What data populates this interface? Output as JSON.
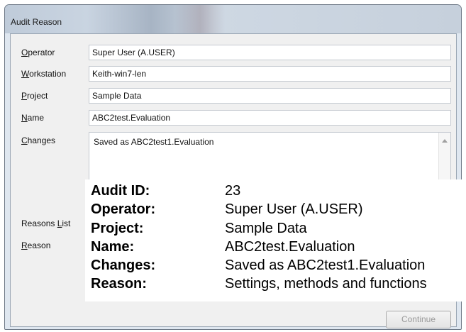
{
  "window": {
    "title": "Audit Reason"
  },
  "form": {
    "operator": {
      "label_ul": "O",
      "label_rest": "perator",
      "value": "Super User (A.USER)"
    },
    "workstation": {
      "label_ul": "W",
      "label_rest": "orkstation",
      "value": "Keith-win7-len"
    },
    "project": {
      "label_ul": "P",
      "label_rest": "roject",
      "value": "Sample Data"
    },
    "name": {
      "label_ul": "N",
      "label_rest": "ame",
      "value": "ABC2test.Evaluation"
    },
    "changes": {
      "label_ul": "C",
      "label_rest": "hanges",
      "value": "Saved as ABC2test1.Evaluation"
    },
    "reasons_list": {
      "label_pre": "Reasons ",
      "label_ul": "L",
      "label_rest": "ist"
    },
    "reason": {
      "label_ul": "R",
      "label_rest": "eason"
    }
  },
  "summary": [
    {
      "key": "Audit ID:",
      "value": "23"
    },
    {
      "key": "Operator:",
      "value": "Super User (A.USER)"
    },
    {
      "key": "Project:",
      "value": "Sample Data"
    },
    {
      "key": "Name:",
      "value": "ABC2test.Evaluation"
    },
    {
      "key": "Changes:",
      "value": "Saved as ABC2test1.Evaluation"
    },
    {
      "key": "Reason:",
      "value": "Settings, methods and functions"
    }
  ],
  "buttons": {
    "continue": "Continue"
  },
  "icons": {
    "scroll_up": "scroll-up-arrow-icon"
  }
}
